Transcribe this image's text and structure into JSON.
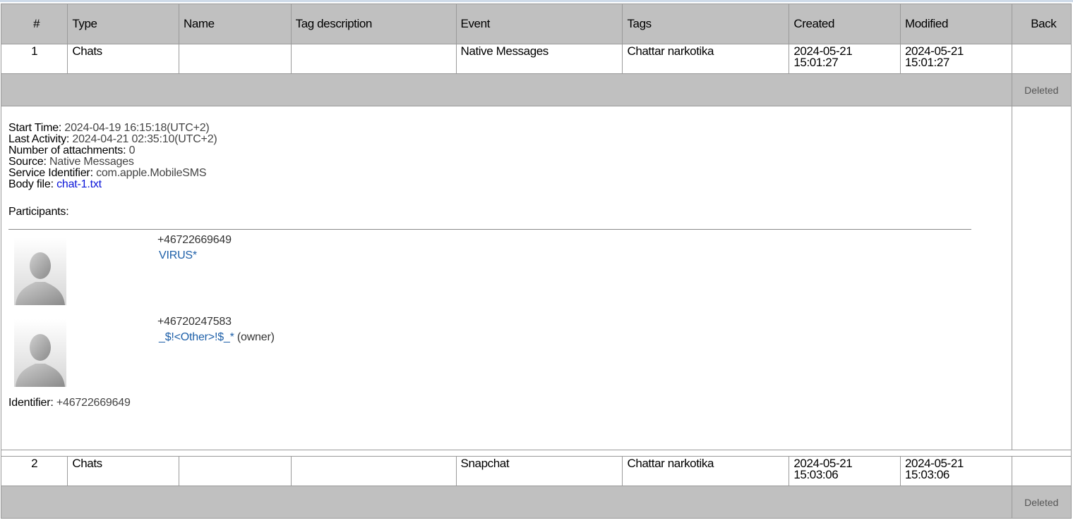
{
  "headers": {
    "num": "#",
    "type": "Type",
    "name": "Name",
    "tag_description": "Tag description",
    "event": "Event",
    "tags": "Tags",
    "created": "Created",
    "modified": "Modified",
    "back": "Back"
  },
  "rows": [
    {
      "num": "1",
      "type": "Chats",
      "name": "",
      "tag_description": "",
      "event": "Native Messages",
      "tags": "Chattar narkotika",
      "created_date": "2024-05-21",
      "created_time": "15:01:27",
      "modified_date": "2024-05-21",
      "modified_time": "15:01:27",
      "status": "Deleted"
    },
    {
      "num": "2",
      "type": "Chats",
      "name": "",
      "tag_description": "",
      "event": "Snapchat",
      "tags": "Chattar narkotika",
      "created_date": "2024-05-21",
      "created_time": "15:03:06",
      "modified_date": "2024-05-21",
      "modified_time": "15:03:06",
      "status": "Deleted"
    }
  ],
  "detail": {
    "start_time_label": "Start Time:",
    "start_time": "2024-04-19 16:15:18(UTC+2)",
    "last_activity_label": "Last Activity:",
    "last_activity": "2024-04-21 02:35:10(UTC+2)",
    "attachments_label": "Number of attachments:",
    "attachments": "0",
    "source_label": "Source:",
    "source": "Native Messages",
    "service_label": "Service Identifier:",
    "service": "com.apple.MobileSMS",
    "body_label": "Body file:",
    "body_file": "chat-1.txt",
    "participants_label": "Participants:",
    "participants": [
      {
        "number": "+46722669649",
        "name": "VIRUS*",
        "suffix": ""
      },
      {
        "number": "+46720247583",
        "name": "_$!<Other>!$_*",
        "suffix": " (owner)"
      }
    ],
    "identifier_label": "Identifier:",
    "identifier": "+46722669649"
  },
  "colors": {
    "header_bg": "#c0c0c0",
    "link": "#0a14d8",
    "participant_link": "#1d5fa8"
  },
  "icons": {
    "avatar": "default-person-silhouette-icon"
  }
}
